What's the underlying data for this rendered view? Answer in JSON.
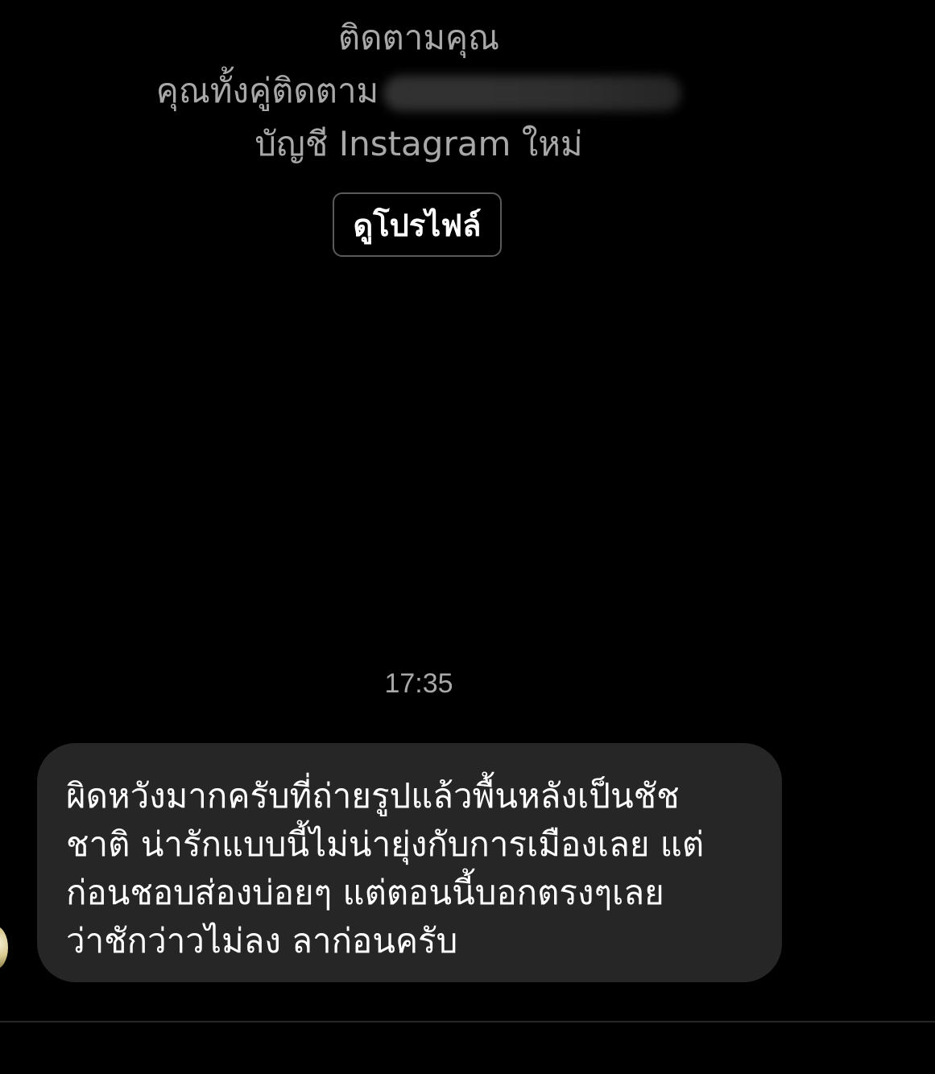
{
  "profile_card": {
    "follow_status": "ติดตามคุณ",
    "mutual_prefix": "คุณทั้งคู่ติดตาม",
    "account_note": "บัญชี Instagram ใหม่",
    "view_profile_label": "ดูโปรไฟล์"
  },
  "thread": {
    "timestamp": "17:35",
    "message": {
      "lines": [
        "ผิดหวังมากครับที่ถ่ายรูปแล้วพื้นหลังเป็นชัช",
        "ชาติ น่ารักแบบนี้ไม่น่ายุ่งกับการเมืองเลย แต่",
        "ก่อนชอบส่องบ่อยๆ แต่ตอนนี้บอกตรงๆเลย",
        "ว่าชักว่าวไม่ลง ลาก่อนครับ"
      ]
    }
  },
  "colors": {
    "background": "#000000",
    "bubble": "#262626",
    "secondary_text": "#a8a8a8",
    "primary_text": "#ffffff"
  }
}
